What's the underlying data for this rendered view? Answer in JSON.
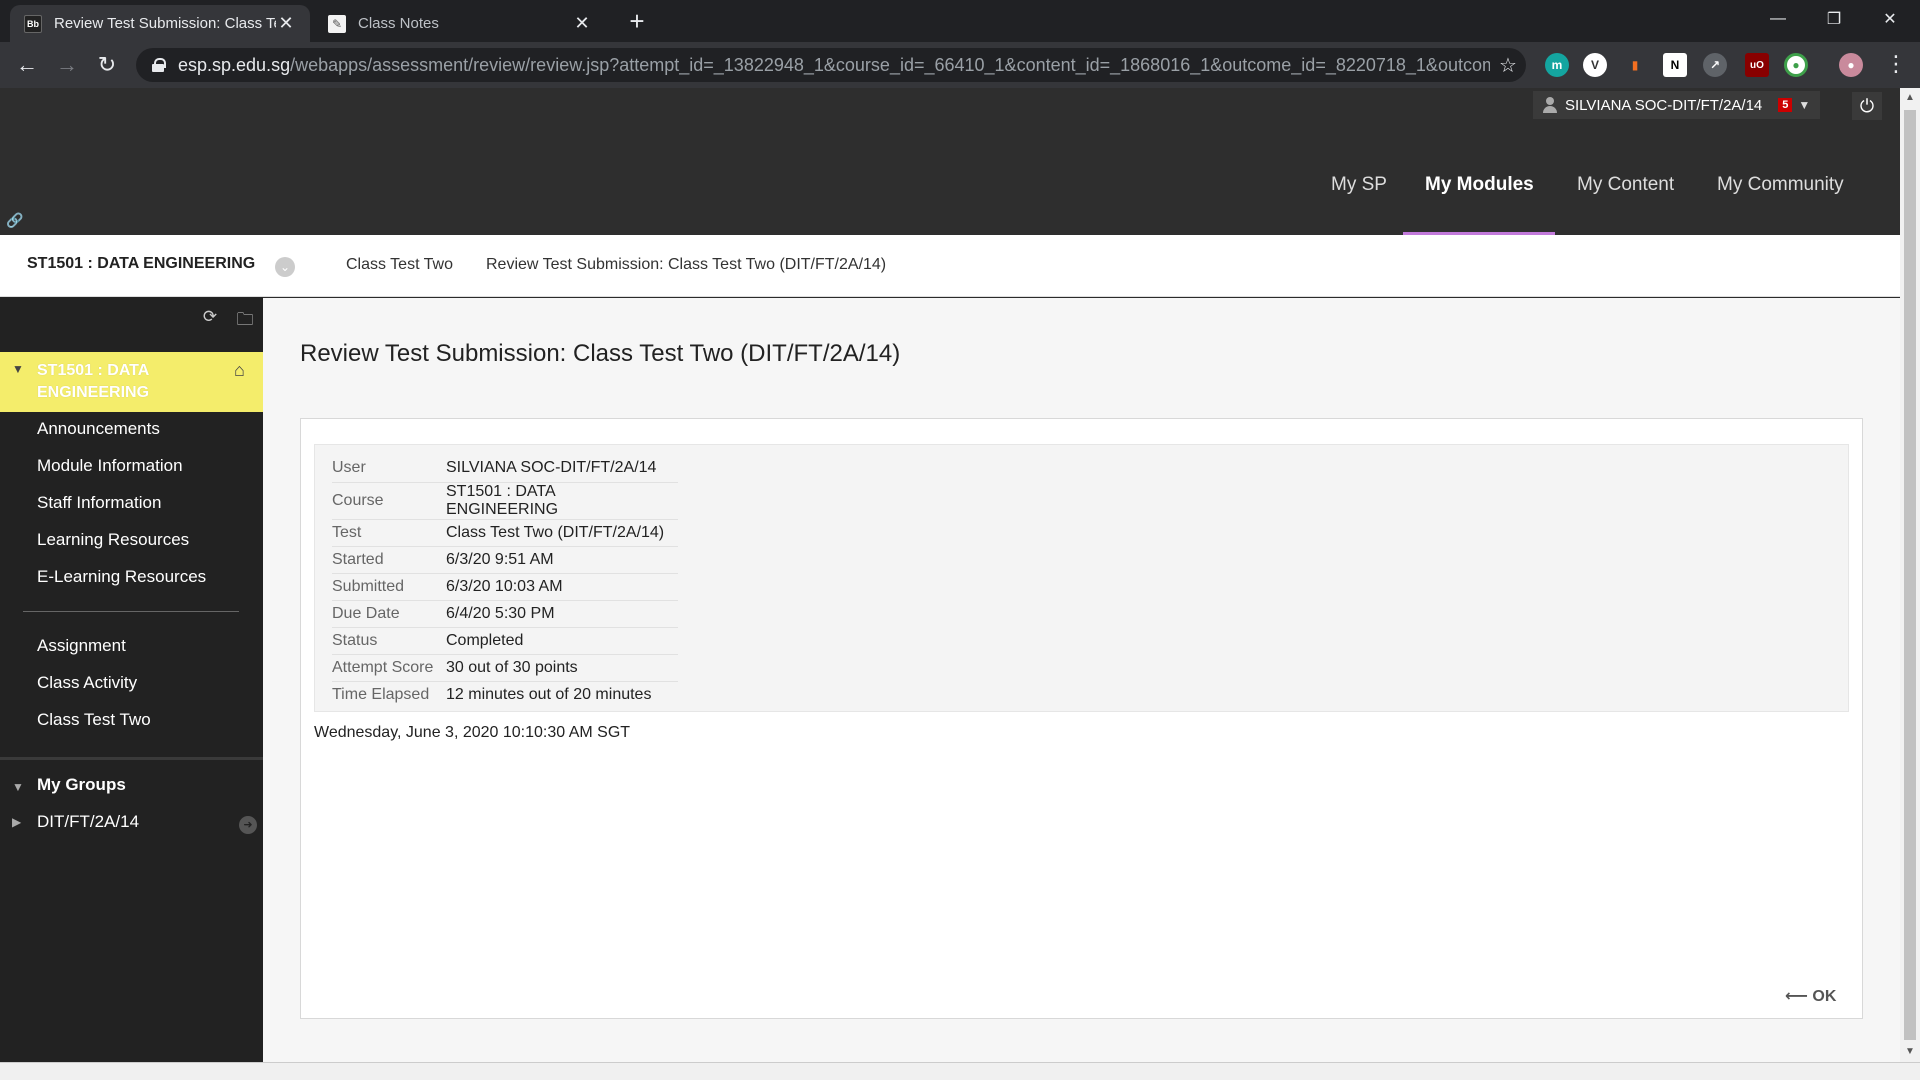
{
  "browser": {
    "tabs": [
      {
        "title": "Review Test Submission: Class Test Two (DIT/FT/2A/14)",
        "favicon": "Bb"
      },
      {
        "title": "Class Notes",
        "favicon": "notes"
      }
    ],
    "url_host": "esp.sp.edu.sg",
    "url_path": "/webapps/assessment/review/review.jsp?attempt_id=_13822948_1&course_id=_66410_1&content_id=_1868016_1&outcome_id=_8220718_1&outcome_d..."
  },
  "header": {
    "user_name": "SILVIANA SOC-DIT/FT/2A/14",
    "notification_count": "5",
    "nav": [
      "My SP",
      "My Modules",
      "My Content",
      "My Community"
    ],
    "active_nav": "My Modules"
  },
  "breadcrumb": {
    "course": "ST1501 : DATA ENGINEERING",
    "items": [
      "Class Test Two",
      "Review Test Submission: Class Test Two (DIT/FT/2A/14)"
    ]
  },
  "course_menu": {
    "course_name": "ST1501 : DATA ENGINEERING",
    "items_top": [
      "Announcements",
      "Module Information",
      "Staff Information",
      "Learning Resources",
      "E-Learning Resources"
    ],
    "items_bottom": [
      "Assignment",
      "Class Activity",
      "Class Test Two"
    ],
    "groups_label": "My Groups",
    "group": "DIT/FT/2A/14"
  },
  "main": {
    "title": "Review Test Submission: Class Test Two (DIT/FT/2A/14)",
    "details": [
      {
        "label": "User",
        "value": "SILVIANA SOC-DIT/FT/2A/14"
      },
      {
        "label": "Course",
        "value": "ST1501 : DATA ENGINEERING"
      },
      {
        "label": "Test",
        "value": "Class Test Two (DIT/FT/2A/14)"
      },
      {
        "label": "Started",
        "value": "6/3/20 9:51 AM"
      },
      {
        "label": "Submitted",
        "value": "6/3/20 10:03 AM"
      },
      {
        "label": "Due Date",
        "value": "6/4/20 5:30 PM"
      },
      {
        "label": "Status",
        "value": "Completed"
      },
      {
        "label": "Attempt Score",
        "value": "30 out of 30 points"
      },
      {
        "label": "Time Elapsed",
        "value": "12 minutes out of 20 minutes"
      }
    ],
    "timestamp": "Wednesday, June 3, 2020 10:10:30 AM SGT",
    "ok_label": "OK"
  },
  "colors": {
    "accent_underline": "#c27adb",
    "course_highlight": "#f4ed6b"
  }
}
